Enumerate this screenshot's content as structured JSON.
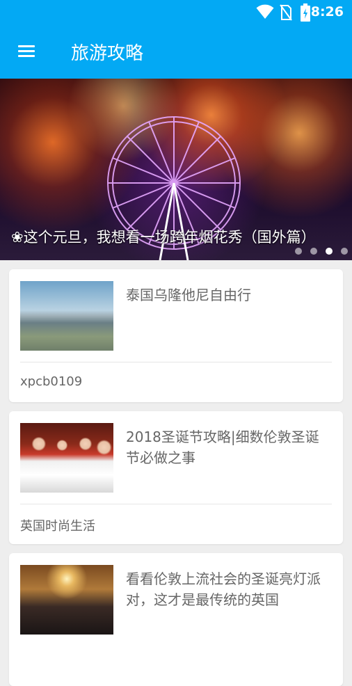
{
  "status_bar": {
    "time": "8:26"
  },
  "app_bar": {
    "title": "旅游攻略"
  },
  "banner": {
    "caption": "❀这个元旦，我想看一场跨年烟花秀（国外篇）",
    "slides_count": 4,
    "active_slide": 3
  },
  "articles": [
    {
      "title": "泰国乌隆他尼自由行",
      "source": "xpcb0109"
    },
    {
      "title": "2018圣诞节攻略|细数伦敦圣诞节必做之事",
      "source": "英国时尚生活"
    },
    {
      "title": "看看伦敦上流社会的圣诞亮灯派对，这才是最传统的英国",
      "source": ""
    }
  ],
  "colors": {
    "primary": "#03a9f4",
    "background": "#eeeeee",
    "text": "#666666"
  }
}
